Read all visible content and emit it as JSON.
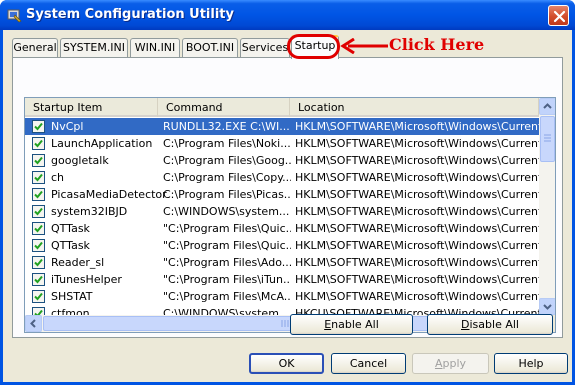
{
  "window": {
    "title": "System Configuration Utility"
  },
  "tabs": [
    {
      "label": "General"
    },
    {
      "label": "SYSTEM.INI"
    },
    {
      "label": "WIN.INI"
    },
    {
      "label": "BOOT.INI"
    },
    {
      "label": "Services"
    },
    {
      "label": "Startup"
    }
  ],
  "annotation": {
    "text": "Click Here",
    "color": "#e00000"
  },
  "table": {
    "columns": [
      "Startup Item",
      "Command",
      "Location"
    ],
    "rows": [
      {
        "item": "NvCpl",
        "command": "RUNDLL32.EXE C:\\WI...",
        "location": "HKLM\\SOFTWARE\\Microsoft\\Windows\\CurrentVer...",
        "checked": true,
        "selected": true
      },
      {
        "item": "LaunchApplication",
        "command": "C:\\Program Files\\Noki...",
        "location": "HKLM\\SOFTWARE\\Microsoft\\Windows\\CurrentVer...",
        "checked": true
      },
      {
        "item": "googletalk",
        "command": "C:\\Program Files\\Goog...",
        "location": "HKLM\\SOFTWARE\\Microsoft\\Windows\\CurrentVer...",
        "checked": true
      },
      {
        "item": "ch",
        "command": "C:\\Program Files\\Copy...",
        "location": "HKLM\\SOFTWARE\\Microsoft\\Windows\\CurrentVer...",
        "checked": true
      },
      {
        "item": "PicasaMediaDetector",
        "command": "C:\\Program Files\\Picas...",
        "location": "HKLM\\SOFTWARE\\Microsoft\\Windows\\CurrentVer...",
        "checked": true
      },
      {
        "item": "system32IBJD",
        "command": "C:\\WINDOWS\\system...",
        "location": "HKLM\\SOFTWARE\\Microsoft\\Windows\\CurrentVer...",
        "checked": true
      },
      {
        "item": "QTTask",
        "command": "\"C:\\Program Files\\Quic...",
        "location": "HKLM\\SOFTWARE\\Microsoft\\Windows\\CurrentVer...",
        "checked": true
      },
      {
        "item": "QTTask",
        "command": "\"C:\\Program Files\\Quic...",
        "location": "HKLM\\SOFTWARE\\Microsoft\\Windows\\CurrentVer...",
        "checked": true
      },
      {
        "item": "Reader_sl",
        "command": "\"C:\\Program Files\\Ado...",
        "location": "HKLM\\SOFTWARE\\Microsoft\\Windows\\CurrentVer...",
        "checked": true
      },
      {
        "item": "iTunesHelper",
        "command": "\"C:\\Program Files\\iTun...",
        "location": "HKLM\\SOFTWARE\\Microsoft\\Windows\\CurrentVer...",
        "checked": true
      },
      {
        "item": "SHSTAT",
        "command": "\"C:\\Program Files\\McA...",
        "location": "HKLM\\SOFTWARE\\Microsoft\\Windows\\CurrentVer...",
        "checked": true
      },
      {
        "item": "ctfmon",
        "command": "C:\\WINDOWS\\system...",
        "location": "HKCU\\SOFTWARE\\Microsoft\\Windows\\CurrentVer...",
        "checked": true
      }
    ]
  },
  "buttons": {
    "enable_all": "Enable All",
    "disable_all": "Disable All",
    "ok": "OK",
    "cancel": "Cancel",
    "apply": "Apply",
    "help": "Help"
  },
  "colors": {
    "titlebar": "#0054e3",
    "selection": "#316ac5",
    "dialog_bg": "#ece9d8"
  }
}
